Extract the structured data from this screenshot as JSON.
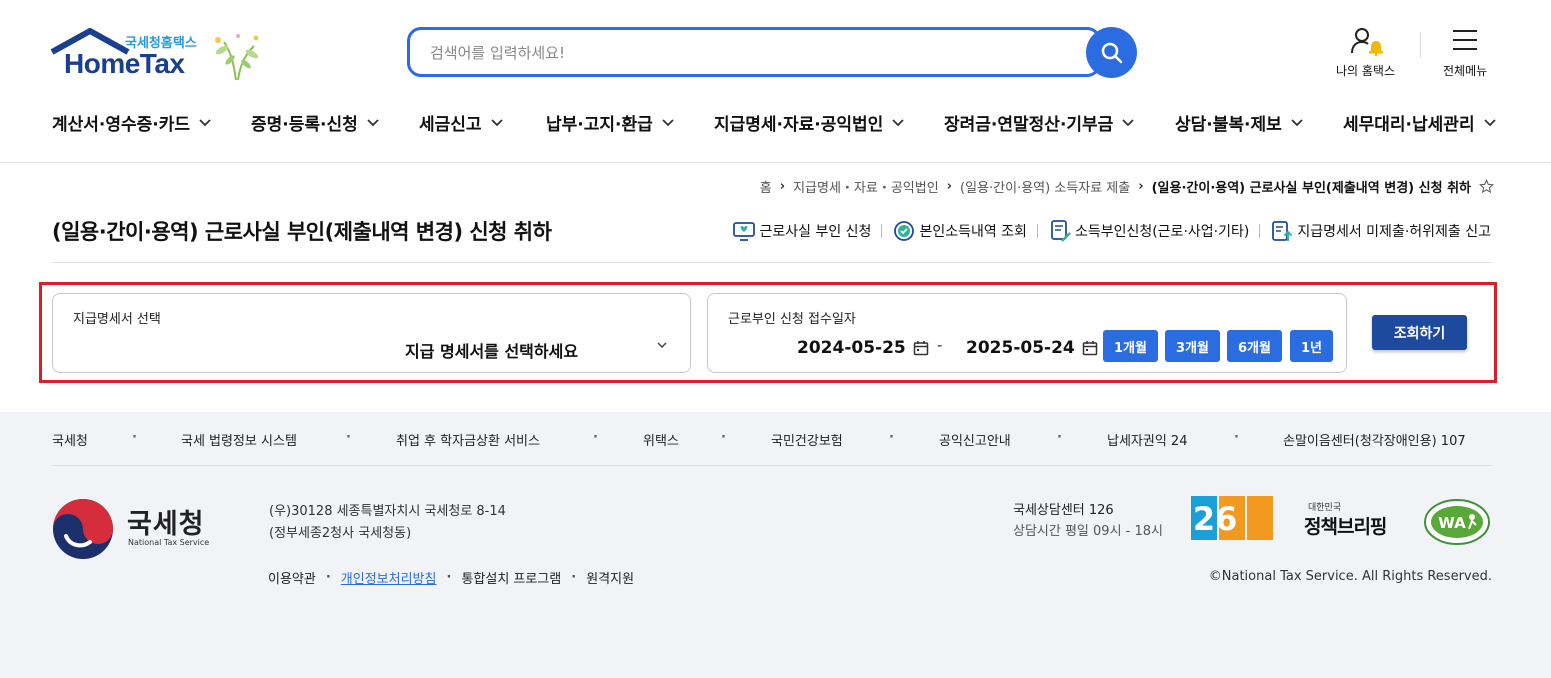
{
  "header": {
    "logo_sub": "국세청홈택스",
    "logo_main": "HomeTax",
    "search_placeholder": "검색어를 입력하세요!",
    "my_hometax": "나의 홈택스",
    "all_menu": "전체메뉴"
  },
  "gnb": [
    "계산서·영수증·카드",
    "증명·등록·신청",
    "세금신고",
    "납부·고지·환급",
    "지급명세·자료·공익법인",
    "장려금·연말정산·기부금",
    "상담·불복·제보",
    "세무대리·납세관리"
  ],
  "breadcrumb": {
    "home": "홈",
    "item1": "지급명세・자료・공익법인",
    "item2": "(일용·간이·용역) 소득자료 제출",
    "current": "(일용·간이·용역) 근로사실 부인(제출내역 변경) 신청 취하"
  },
  "page_title": "(일용·간이·용역) 근로사실 부인(제출내역 변경) 신청 취하",
  "quick_links": [
    "근로사실 부인 신청",
    "본인소득내역 조회",
    "소득부인신청(근로·사업·기타)",
    "지급명세서 미제출·허위제출 신고"
  ],
  "form": {
    "select_label": "지급명세서 선택",
    "select_value": "지급 명세서를 선택하세요",
    "date_label": "근로부인 신청 접수일자",
    "date_from": "2024-05-25",
    "date_to": "2025-05-24",
    "date_dash": "-",
    "periods": [
      "1개월",
      "3개월",
      "6개월",
      "1년"
    ],
    "submit": "조회하기"
  },
  "footer": {
    "links": [
      "국세청",
      "국세 법령정보 시스템",
      "취업 후 학자금상환 서비스",
      "위택스",
      "국민건강보험",
      "공익신고안내",
      "납세자권익 24",
      "손말이음센터(청각장애인용) 107"
    ],
    "org_name": "국세청",
    "org_en": "National Tax Service",
    "address1": "(우)30128 세종특별자치시 국세청로 8-14",
    "address2": "(정부세종2청사 국세청동)",
    "bottom_links": [
      "이용약관",
      "개인정보처리방침",
      "통합설치 프로그램",
      "원격지원"
    ],
    "center_title": "국세상담센터 126",
    "center_hours": "상담시간 평일 09시 - 18시",
    "badge_126": "126",
    "briefing_small": "대한민국",
    "briefing_big": "정책브리핑",
    "wa_text": "WA",
    "copyright": "©National Tax Service. All Rights Reserved."
  },
  "colors": {
    "primary_blue": "#2b6de0",
    "navy": "#1e4a9e",
    "highlight_red": "#d9202a",
    "footer_bg": "#f2f3f7"
  }
}
